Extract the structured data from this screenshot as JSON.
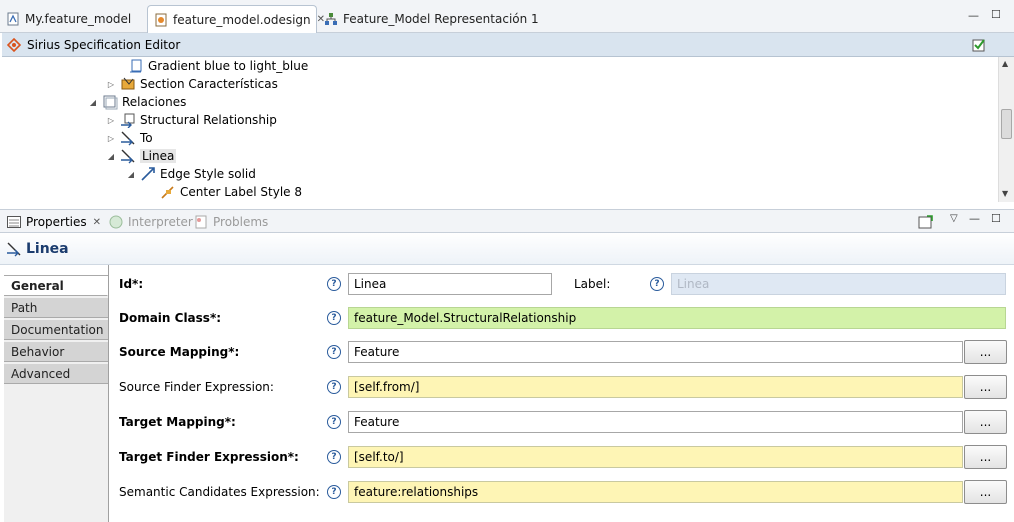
{
  "editor_tabs": [
    {
      "label": "My.feature_model",
      "icon": "feature-model-file-icon",
      "active": false
    },
    {
      "label": "feature_model.odesign",
      "icon": "odesign-file-icon",
      "active": true,
      "close": "✕"
    },
    {
      "label": "Feature_Model Representación 1",
      "icon": "diagram-icon",
      "active": false
    }
  ],
  "window_controls": {
    "minimize": "—",
    "maximize": "☐"
  },
  "editor_header": {
    "title": "Sirius Specification Editor"
  },
  "tree": [
    {
      "label": "Gradient blue to light_blue",
      "icon": "gradient-style-icon",
      "twisty": ""
    },
    {
      "label": "Section Características",
      "icon": "section-icon",
      "twisty": "▷"
    },
    {
      "label": "Relaciones",
      "icon": "layer-icon",
      "twisty": "◢"
    },
    {
      "label": "Structural Relationship",
      "icon": "edge-mapping-icon",
      "twisty": "▷"
    },
    {
      "label": "To",
      "icon": "edge-mapping-icon",
      "twisty": "▷"
    },
    {
      "label": "Linea",
      "icon": "edge-mapping-icon",
      "twisty": "◢",
      "selected": true
    },
    {
      "label": "Edge Style solid",
      "icon": "edge-style-icon",
      "twisty": "◢"
    },
    {
      "label": "Center Label Style 8",
      "icon": "label-style-icon",
      "twisty": ""
    }
  ],
  "view_tabs": [
    {
      "label": "Properties",
      "active": true,
      "close": "✕"
    },
    {
      "label": "Interpreter",
      "active": false
    },
    {
      "label": "Problems",
      "active": false
    }
  ],
  "properties": {
    "title": "Linea",
    "side_tabs": [
      "General",
      "Path",
      "Documentation",
      "Behavior",
      "Advanced"
    ],
    "active_side_tab": "General",
    "help_glyph": "?",
    "browse_label": "...",
    "fields": {
      "id": {
        "label": "Id*:",
        "value": "Linea"
      },
      "label": {
        "label": "Label:",
        "value": "Linea"
      },
      "domain_class": {
        "label": "Domain Class*:",
        "value": "feature_Model.StructuralRelationship"
      },
      "source_mapping": {
        "label": "Source Mapping*:",
        "value": "Feature"
      },
      "source_finder": {
        "label": "Source Finder Expression:",
        "value": "[self.from/]"
      },
      "target_mapping": {
        "label": "Target Mapping*:",
        "value": "Feature"
      },
      "target_finder": {
        "label": "Target Finder Expression*:",
        "value": "[self.to/]"
      },
      "semantic_candidates": {
        "label": "Semantic Candidates Expression:",
        "value": "feature:relationships"
      }
    }
  },
  "colors": {
    "domain_class_bg": "#d3f2a9",
    "expression_bg": "#fef5b5",
    "header_bg": "#d9e4ef",
    "title_text": "#1b3c6e"
  }
}
